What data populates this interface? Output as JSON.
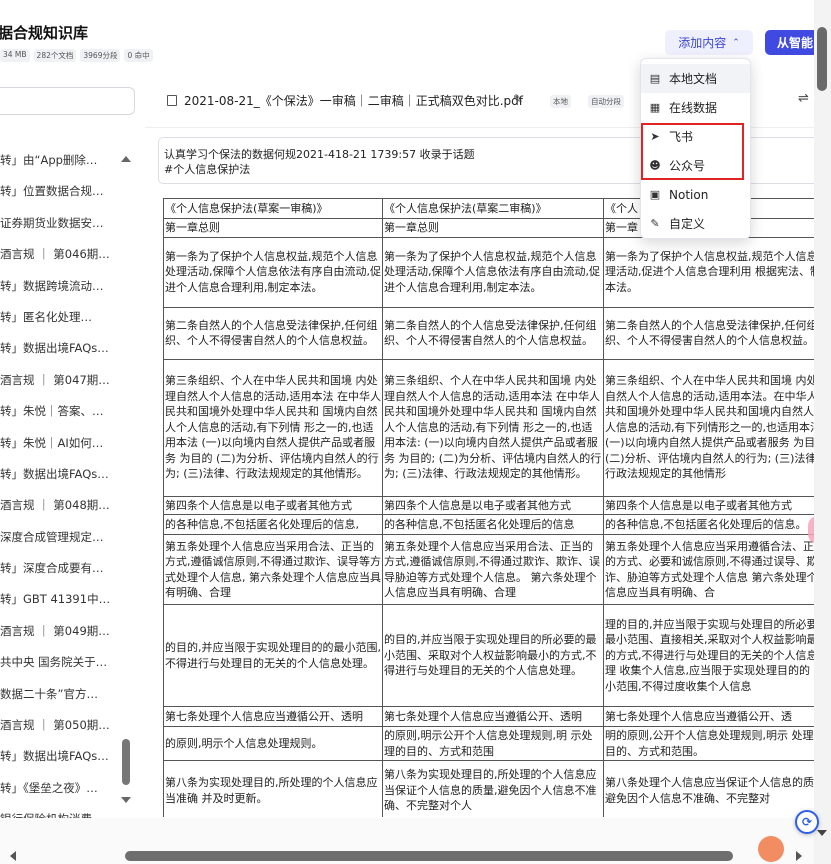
{
  "header": {
    "title": "据合规知识库",
    "stats": [
      "34 MB",
      "282个文档",
      "3969分段",
      "0 命中"
    ],
    "add_content_label": "添加内容",
    "smart_button_label": "从智能"
  },
  "sidebar": {
    "items": [
      "转」由“App删除…",
      "转」位置数据合规…",
      "证券期货业数据安…",
      "酒言规 ｜ 第046期…",
      "转」数据跨境流动…",
      "转」匿名化处理…",
      "转」数据出境FAQs…",
      "酒言规 ｜ 第047期…",
      "转」朱悦｜答案、…",
      "转」朱悦｜AI如何…",
      "转」数据出境FAQs…",
      "酒言规 ｜ 第048期…",
      "深度合成管理规定…",
      "转」深度合成要有…",
      "转」GBT 41391中…",
      "酒言规 ｜ 第049期…",
      "共中央 国务院关于…",
      "数据二十条”官方…",
      "酒言规 ｜ 第050期…",
      "转」数据出境FAQs…",
      "转」《堡垒之夜》…",
      "银行保险机构消费…"
    ]
  },
  "document": {
    "title": "2021-08-21_《个保法》一审稿｜二审稿｜正式稿双色对比.pdf",
    "tags": [
      "本地",
      "自动分段"
    ],
    "note_line1": "认真学习个保法的数据何规2021-418-21 1739:57 收录于话题",
    "note_line2": "#个人信息保护法"
  },
  "table": {
    "rows": [
      [
        "《个人信息保护法(草案一审稿)》",
        "《个人信息保护法(草案二审稿)》",
        "《个人"
      ],
      [
        "第一章总则",
        "第一章总则",
        "第一章"
      ],
      [
        "第一条为了保护个人信息权益,规范个人信息处理活动,保障个人信息依法有序自由流动,促进个人信息合理利用,制定本法。",
        "第一条为了保护个人信息权益,规范个人信息处理活动,保障个人信息依法有序自由流动,促进个人信息合理利用,制定本法。",
        "第一条为了保护个人信息权益,规范个人信息处理活动,促进个人信息合理利用 根据宪法、制定本法。"
      ],
      [
        "第二条自然人的个人信息受法律保护,任何组织、个人不得侵害自然人的个人信息权益。",
        "第二条自然人的个人信息受法律保护,任何组织、个人不得侵害自然人的个人信息权益。",
        "第二条自然人的个人信息受法律保护,任何组织、个人不得侵害自然人的个人信息权益。"
      ],
      [
        "第三条组织、个人在中华人民共和国境 内处理自然人个人信息的活动,适用本法 在中华人民共和国境外处理中华人民共和 国境内自然人个人信息的活动,有下列情 形之一的,也适用本法 (一)以向境内自然人提供产品或者服务 为目的 (二)为分析、评估境内自然人的行为; (三)法律、行政法规规定的其他情形。",
        "第三条组织、个人在中华人民共和国境 内处理自然人个人信息的活动,适用本法 在中华人民共和国境外处理中华人民共和 国境内自然人个人信息的活动,有下列情 形之一的,也适用本法: (一)以向境内自然人提供产品或者服务 为目的; (二)为分析、评估境内自然人的行为; (三)法律、行政法规规定的其他情形。",
        "第三条组织、个人在中华人民共和国境 内处理自然人个人信息的活动,适用本法。在中华人民共和国境外处理中华人民共和国境内自然人个人信息的活动,有下列情形之一的,也适用本法 (一)以向境内自然人提供产品或者服务 为目的; (二)分析、评估境内自然人的行为; (三)法律、行政法规规定的其他情形"
      ],
      [
        "第四条个人信息是以电子或者其他方式",
        "第四条个人信息是以电子或者其他方式",
        "第四条个人信息是以电子或者其他方式"
      ],
      [
        "的各种信息,不包括匿名化处理后的信息,",
        "的各种信息,不包括匿名化处理后的信息",
        "的各种信息,不包括匿名化处理后的信息。"
      ],
      [
        "第五条处理个人信息应当采用合法、正当的方式,遵循诚信原则,不得通过欺诈、误导等方式处理个人信息, 第六条处理个人信息应当具有明确、合理",
        "第五条处理个人信息应当采用合法、正当的方式,遵循诚信原则,不得通过欺诈、欺诈、误导胁迫等方式处理个人信息。 第六条处理个人信息应当具有明确、合理",
        "第五条处理个人信息应当采用遵循合法、正当的方式、必要和诚信原则,不得通过误导、欺诈、胁迫等方式处理个人信息 第六条处理个人信息应当具有明确、合"
      ],
      [
        "的目的,并应当限于实现处理目的的最小范围,不得进行与处理目的无关的个人信息处理。",
        "的目的,并应当限于实现处理目的所必要的最小范围、采取对个人权益影响最小的方式,不得进行与处理目的无关的个人信息处理。",
        "理的目的,并应当限于实现与处理目的所必要的最小范围、直接相关,采取对个人权益影响最小的方式,不得进行与处理目的无关的个人信息处理 收集个人信息,应当限于实现处理目的的 最小范围,不得过度收集个人信息"
      ],
      [
        "第七条处理个人信息应当遵循公开、透明",
        "第七条处理个人信息应当遵循公开、透明",
        "第七条处理个人信息应当遵循公开、透"
      ],
      [
        "的原则,明示个人信息处理规则。",
        "的原则,明示公开个人信息处理规则,明 示处理的目的、方式和范围",
        "明的原则,公开个人信息处理规则,明示 处理的目的、方式和范围。"
      ],
      [
        "第八条为实现处理目的,所处理的个人信息应当准确 并及时更新。",
        "第八条为实现处理目的,所处理的个人信息应当保证个人信息的质量,避免因个人信息不准确、不完整对个人",
        "第八条处理个人信息应当保证个人信息的质量,避免因个人信息不准确、不完整对"
      ]
    ]
  },
  "dropdown": {
    "items": [
      {
        "label": "本地文档",
        "icon": "file-icon"
      },
      {
        "label": "在线数据",
        "icon": "online-data-icon"
      },
      {
        "label": "飞书",
        "icon": "feishu-icon"
      },
      {
        "label": "公众号",
        "icon": "wechat-icon"
      },
      {
        "label": "Notion",
        "icon": "notion-icon"
      },
      {
        "label": "自定义",
        "icon": "custom-icon"
      }
    ]
  },
  "colors": {
    "accent": "#4049e0",
    "accent_light": "#eef0fd",
    "highlight_box": "#e02424"
  }
}
